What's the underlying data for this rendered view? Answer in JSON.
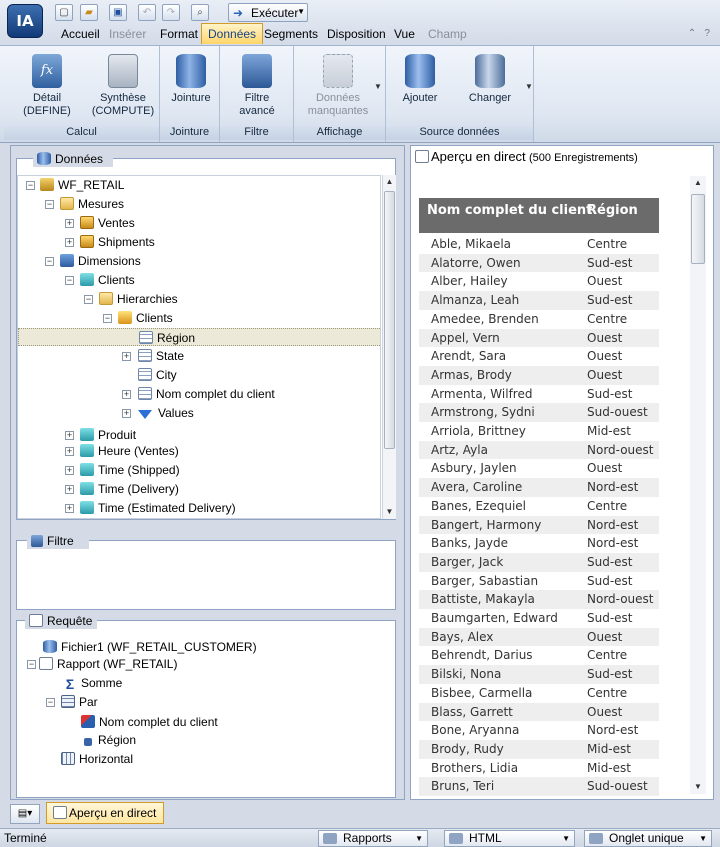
{
  "app": {
    "logo": "IA",
    "run_label": "Exécuter"
  },
  "tabs": [
    {
      "label": "Accueil",
      "state": "normal"
    },
    {
      "label": "Insérer",
      "state": "disabled"
    },
    {
      "label": "Format",
      "state": "normal"
    },
    {
      "label": "Données",
      "state": "active"
    },
    {
      "label": "Segments",
      "state": "normal"
    },
    {
      "label": "Disposition",
      "state": "normal"
    },
    {
      "label": "Vue",
      "state": "normal"
    },
    {
      "label": "Champ",
      "state": "disabled"
    }
  ],
  "ribbon": {
    "groups": {
      "calcul": "Calcul",
      "jointure": "Jointure",
      "filtre": "Filtre",
      "affichage": "Affichage",
      "source": "Source données"
    },
    "buttons": {
      "detail": "Détail\n(DEFINE)",
      "synthese": "Synthèse\n(COMPUTE)",
      "jointure": "Jointure",
      "filtre_avance": "Filtre\navancé",
      "donnees_manquantes": "Données\nmanquantes",
      "ajouter": "Ajouter",
      "changer": "Changer"
    }
  },
  "data_panel": {
    "title": "Données",
    "tree": {
      "root": "WF_RETAIL",
      "mesures": "Mesures",
      "ventes": "Ventes",
      "shipments": "Shipments",
      "dimensions": "Dimensions",
      "clients": "Clients",
      "hierarchies": "Hierarchies",
      "clients_h": "Clients",
      "region": "Région",
      "state": "State",
      "city": "City",
      "nom_complet": "Nom complet du client",
      "values": "Values",
      "produit": "Produit",
      "heure_ventes": "Heure (Ventes)",
      "time_shipped": "Time (Shipped)",
      "time_delivery": "Time (Delivery)",
      "time_est": "Time (Estimated Delivery)"
    }
  },
  "filter_panel": {
    "title": "Filtre"
  },
  "request_panel": {
    "title": "Requête",
    "file": "Fichier1 (WF_RETAIL_CUSTOMER)",
    "rapport": "Rapport (WF_RETAIL)",
    "somme": "Somme",
    "par": "Par",
    "nom_complet": "Nom complet du client",
    "region": "Région",
    "horizontal": "Horizontal"
  },
  "preview": {
    "title": "Aperçu en direct",
    "subtitle": "(500 Enregistrements)",
    "columns": [
      "Nom complet du client",
      "Région"
    ],
    "rows": [
      [
        "Able, Mikaela",
        "Centre"
      ],
      [
        "Alatorre, Owen",
        "Sud-est"
      ],
      [
        "Alber, Hailey",
        "Ouest"
      ],
      [
        "Almanza, Leah",
        "Sud-est"
      ],
      [
        "Amedee, Brenden",
        "Centre"
      ],
      [
        "Appel, Vern",
        "Ouest"
      ],
      [
        "Arendt, Sara",
        "Ouest"
      ],
      [
        "Armas, Brody",
        "Ouest"
      ],
      [
        "Armenta, Wilfred",
        "Sud-est"
      ],
      [
        "Armstrong, Sydni",
        "Sud-ouest"
      ],
      [
        "Arriola, Brittney",
        "Mid-est"
      ],
      [
        "Artz, Ayla",
        "Nord-ouest"
      ],
      [
        "Asbury, Jaylen",
        "Ouest"
      ],
      [
        "Avera, Caroline",
        "Nord-est"
      ],
      [
        "Banes, Ezequiel",
        "Centre"
      ],
      [
        "Bangert, Harmony",
        "Nord-est"
      ],
      [
        "Banks, Jayde",
        "Nord-est"
      ],
      [
        "Barger, Jack",
        "Sud-est"
      ],
      [
        "Barger, Sabastian",
        "Sud-est"
      ],
      [
        "Battiste, Makayla",
        "Nord-ouest"
      ],
      [
        "Baumgarten, Edward",
        "Sud-est"
      ],
      [
        "Bays, Alex",
        "Ouest"
      ],
      [
        "Behrendt, Darius",
        "Centre"
      ],
      [
        "Bilski, Nona",
        "Sud-est"
      ],
      [
        "Bisbee, Carmella",
        "Centre"
      ],
      [
        "Blass, Garrett",
        "Ouest"
      ],
      [
        "Bone, Aryanna",
        "Nord-est"
      ],
      [
        "Brody, Rudy",
        "Mid-est"
      ],
      [
        "Brothers, Lidia",
        "Mid-est"
      ],
      [
        "Bruns, Teri",
        "Sud-ouest"
      ]
    ]
  },
  "bottom_tab": "Aperçu en direct",
  "status": {
    "text": "Terminé",
    "rapports": "Rapports",
    "format": "HTML",
    "onglet": "Onglet unique"
  }
}
